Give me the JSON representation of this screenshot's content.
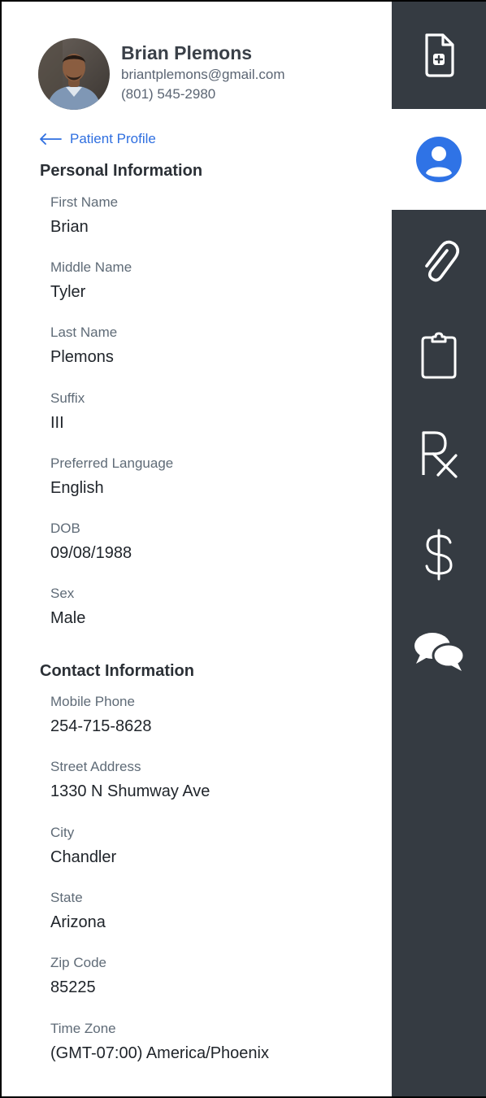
{
  "patient": {
    "name": "Brian Plemons",
    "email": "briantplemons@gmail.com",
    "phone": "(801) 545-2980"
  },
  "back_link": {
    "label": "Patient Profile"
  },
  "personal": {
    "title": "Personal Information",
    "fields": [
      {
        "label": "First Name",
        "value": "Brian"
      },
      {
        "label": "Middle Name",
        "value": "Tyler"
      },
      {
        "label": "Last Name",
        "value": "Plemons"
      },
      {
        "label": "Suffix",
        "value": "III"
      },
      {
        "label": "Preferred Language",
        "value": "English"
      },
      {
        "label": "DOB",
        "value": "09/08/1988"
      },
      {
        "label": "Sex",
        "value": "Male"
      }
    ]
  },
  "contact": {
    "title": "Contact Information",
    "fields": [
      {
        "label": "Mobile Phone",
        "value": "254-715-8628"
      },
      {
        "label": "Street Address",
        "value": "1330 N Shumway Ave"
      },
      {
        "label": "City",
        "value": "Chandler"
      },
      {
        "label": "State",
        "value": "Arizona"
      },
      {
        "label": "Zip Code",
        "value": "85225"
      },
      {
        "label": "Time Zone",
        "value": "(GMT-07:00) America/Phoenix"
      }
    ]
  },
  "rail": {
    "items": [
      {
        "icon": "document-plus-icon",
        "active": false
      },
      {
        "icon": "user-circle-icon",
        "active": true
      },
      {
        "icon": "paperclip-icon",
        "active": false
      },
      {
        "icon": "clipboard-icon",
        "active": false
      },
      {
        "icon": "rx-icon",
        "active": false
      },
      {
        "icon": "dollar-icon",
        "active": false
      },
      {
        "icon": "chat-bubbles-icon",
        "active": false
      }
    ]
  },
  "colors": {
    "rail_bg": "#353b42",
    "accent": "#2f6fe0",
    "active_icon": "#2f73e6"
  }
}
